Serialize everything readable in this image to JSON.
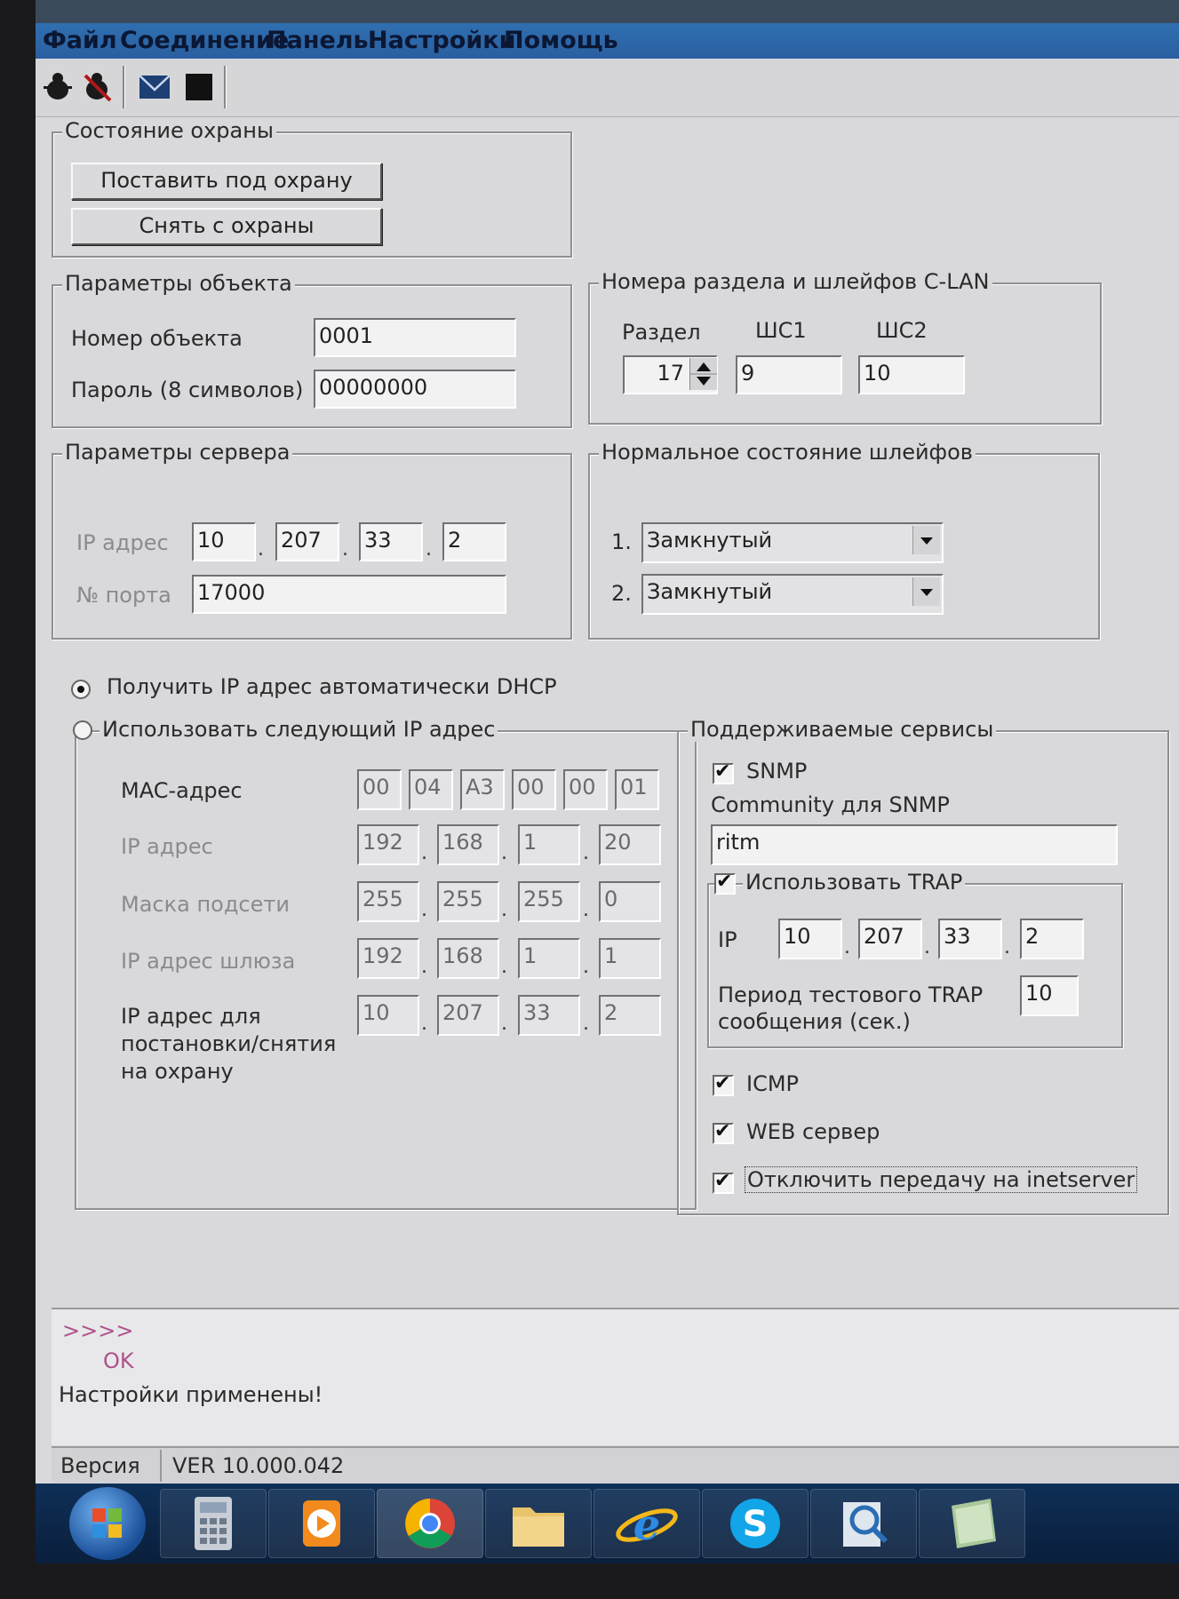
{
  "menu": [
    "Файл",
    "Соединение",
    "Панель",
    "Настройки",
    "Помощь"
  ],
  "toolbar": {
    "icons": [
      "connect-icon",
      "disconnect-icon",
      "mail-icon",
      "stop-icon"
    ]
  },
  "guard": {
    "title": "Состояние охраны",
    "arm_label": "Поставить под охрану",
    "disarm_label": "Снять с охраны"
  },
  "object": {
    "title": "Параметры объекта",
    "number_label": "Номер объекта",
    "number_value": "0001",
    "password_label": "Пароль (8 символов)",
    "password_value": "00000000"
  },
  "clan": {
    "title": "Номера раздела и шлейфов C-LAN",
    "section_label": "Раздел",
    "sh1_label": "ШС1",
    "sh2_label": "ШС2",
    "section_value": "17",
    "sh1_value": "9",
    "sh2_value": "10"
  },
  "server": {
    "title": "Параметры сервера",
    "ip_label": "IP адрес",
    "ip": [
      "10",
      "207",
      "33",
      "2"
    ],
    "port_label": "№ порта",
    "port_value": "17000"
  },
  "loops": {
    "title": "Нормальное состояние шлейфов",
    "items": [
      {
        "num": "1.",
        "value": "Замкнутый"
      },
      {
        "num": "2.",
        "value": "Замкнутый"
      }
    ]
  },
  "network": {
    "dhcp_label": "Получить IP адрес автоматически DHCP",
    "static_label": "Использовать следующий IP адрес",
    "mac_label": "MAC-адрес",
    "mac": [
      "00",
      "04",
      "A3",
      "00",
      "00",
      "01"
    ],
    "ip_label": "IP адрес",
    "ip": [
      "192",
      "168",
      "1",
      "20"
    ],
    "mask_label": "Маска подсети",
    "mask": [
      "255",
      "255",
      "255",
      "0"
    ],
    "gateway_label": "IP адрес шлюза",
    "gateway": [
      "192",
      "168",
      "1",
      "1"
    ],
    "arm_ip_label_1": "IP адрес для",
    "arm_ip_label_2": "постановки/снятия",
    "arm_ip_label_3": "на охрану",
    "arm_ip": [
      "10",
      "207",
      "33",
      "2"
    ]
  },
  "services": {
    "title": "Поддерживаемые сервисы",
    "snmp_label": "SNMP",
    "community_label": "Community для SNMP",
    "community_value": "ritm",
    "trap_label": "Использовать TRAP",
    "trap_ip_label": "IP",
    "trap_ip": [
      "10",
      "207",
      "33",
      "2"
    ],
    "trap_period_label_1": "Период тестового TRAP",
    "trap_period_label_2": "сообщения (сек.)",
    "trap_period_value": "10",
    "icmp_label": "ICMP",
    "web_label": "WEB сервер",
    "inet_label": "Отключить передачу на inetserver"
  },
  "log": {
    "prompt": ">>>>",
    "ok": "OK",
    "message": "Настройки применены!"
  },
  "status": {
    "version_label": "Версия",
    "version_value": "VER 10.000.042"
  },
  "taskbar": {
    "items": [
      "start-orb-icon",
      "calculator-icon",
      "media-player-icon",
      "chrome-icon",
      "folder-icon",
      "ie-icon",
      "skype-icon",
      "search-tool-icon",
      "notes-icon"
    ]
  }
}
